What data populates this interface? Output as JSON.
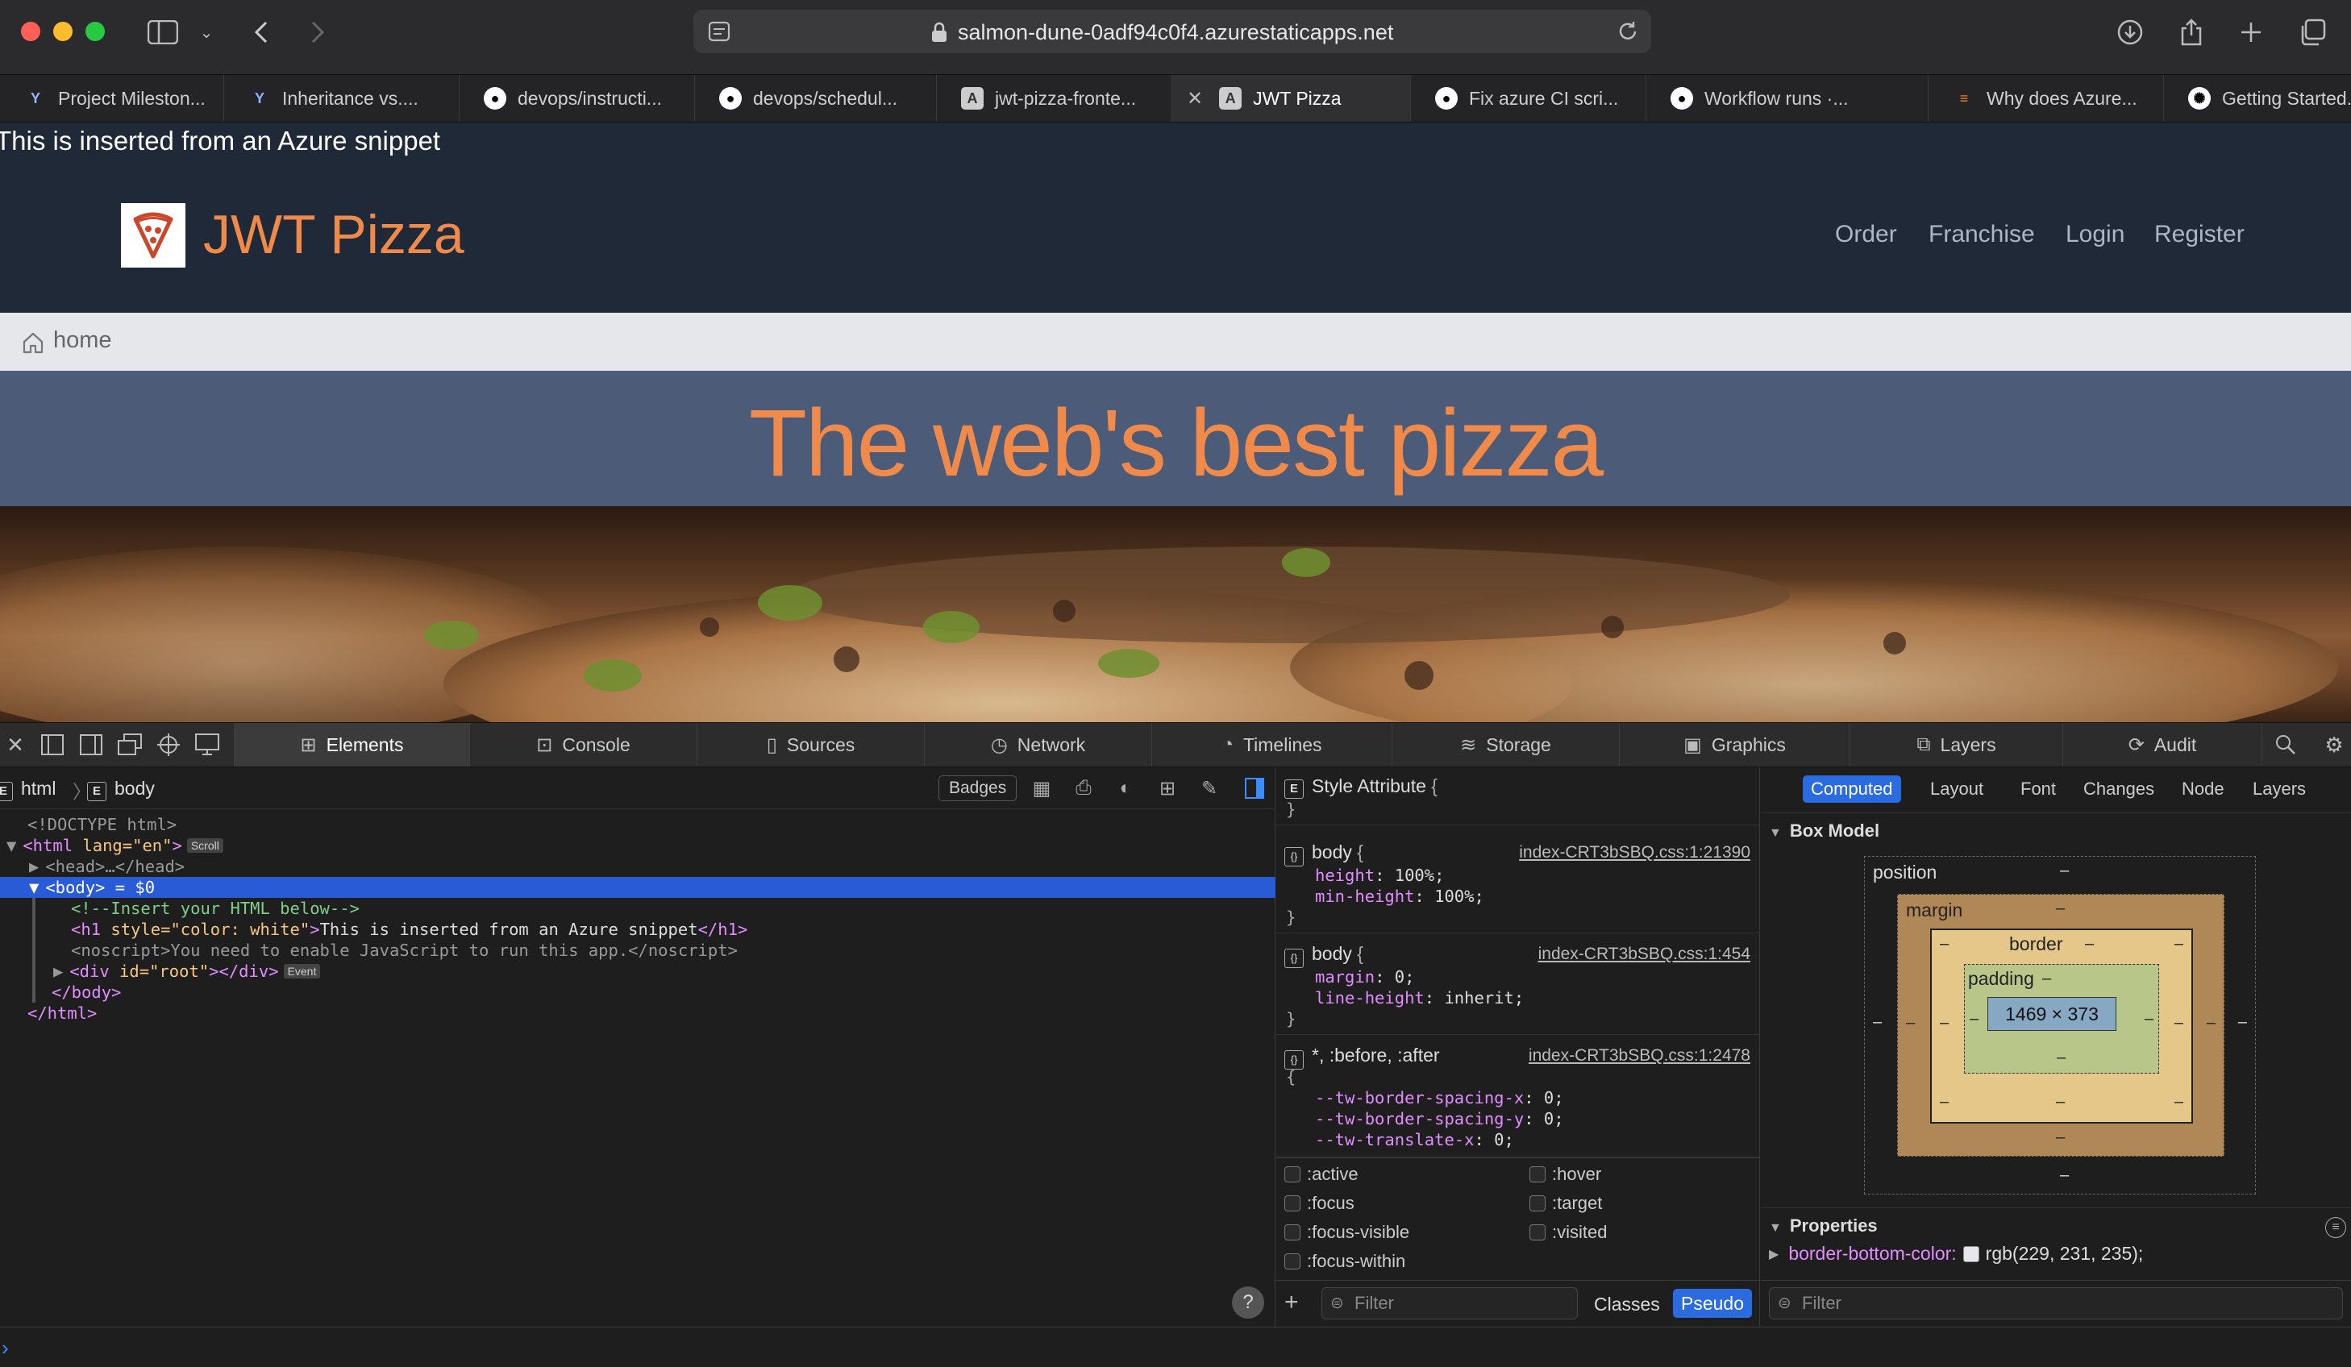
{
  "browser": {
    "url": "salmon-dune-0adf94c0f4.azurestaticapps.net",
    "tabs": [
      {
        "label": "Project Mileston...",
        "icon": "azure-devops-icon"
      },
      {
        "label": "Inheritance vs....",
        "icon": "azure-devops-icon"
      },
      {
        "label": "devops/instructi...",
        "icon": "github-icon"
      },
      {
        "label": "devops/schedul...",
        "icon": "github-icon"
      },
      {
        "label": "jwt-pizza-fronte...",
        "icon": "a-icon"
      },
      {
        "label": "JWT Pizza",
        "icon": "a-icon"
      },
      {
        "label": "Fix azure CI scri...",
        "icon": "github-icon"
      },
      {
        "label": "Workflow runs ·...",
        "icon": "github-icon"
      },
      {
        "label": "Why does Azure...",
        "icon": "stackoverflow-icon"
      },
      {
        "label": "Getting Started...",
        "icon": "openai-icon"
      }
    ]
  },
  "page": {
    "snippet_text": "This is inserted from an Azure snippet",
    "brand": "JWT Pizza",
    "nav": [
      "Order",
      "Franchise",
      "Login",
      "Register"
    ],
    "breadcrumb": "home",
    "headline": "The web's best pizza",
    "colors": {
      "brand": "#f08a4b",
      "header_bg": "#1f2937",
      "hero_bg": "#4c5b78"
    }
  },
  "devtools": {
    "tabs": [
      "Elements",
      "Console",
      "Sources",
      "Network",
      "Timelines",
      "Storage",
      "Graphics",
      "Layers",
      "Audit"
    ],
    "active_tab": "Elements",
    "crumbs": {
      "html": "html",
      "body": "body",
      "badge_letter": "E"
    },
    "badges_label": "Badges",
    "dom": {
      "doctype": "<!DOCTYPE html>",
      "html_open": "<html",
      "lang_attr": " lang=",
      "lang_val": "\"en\"",
      "html_close_bracket": ">",
      "scroll_badge": "Scroll",
      "head_line": "<head>…</head>",
      "body_open": "<body>",
      "body_ref": " = $0",
      "comment": "<!--Insert your HTML below-->",
      "h1_open": "<h1",
      "style_attr": " style=",
      "style_val": "\"color: white\"",
      "h1_gt": ">",
      "h1_text": "This is inserted from an Azure snippet",
      "h1_close": "</h1>",
      "noscript_open": "<noscript>",
      "noscript_text": "You need to enable JavaScript to run this app.",
      "noscript_close": "</noscript>",
      "div_open": "<div",
      "id_attr": " id=",
      "id_val": "\"root\"",
      "div_close": "></div>",
      "event_badge": "Event",
      "body_close": "</body>",
      "html_close": "</html>"
    },
    "help": "?",
    "styles": {
      "style_attribute": "Style Attribute",
      "rules": [
        {
          "selector": "body",
          "source": "index-CRT3bSBQ.css:1:21390",
          "decls": [
            [
              "height",
              "100%"
            ],
            [
              "min-height",
              "100%"
            ]
          ]
        },
        {
          "selector": "body",
          "source": "index-CRT3bSBQ.css:1:454",
          "decls": [
            [
              "margin",
              "0"
            ],
            [
              "line-height",
              "inherit"
            ]
          ]
        },
        {
          "selector": "*, :before, :after",
          "source": "index-CRT3bSBQ.css:1:2478",
          "decls": [
            [
              "--tw-border-spacing-x",
              "0"
            ],
            [
              "--tw-border-spacing-y",
              "0"
            ],
            [
              "--tw-translate-x",
              "0"
            ]
          ]
        }
      ],
      "pseudo_left": [
        ":active",
        ":focus",
        ":focus-visible",
        ":focus-within"
      ],
      "pseudo_right": [
        ":hover",
        ":target",
        ":visited"
      ],
      "filter_placeholder": "Filter",
      "classes_label": "Classes",
      "pseudo_label": "Pseudo"
    },
    "computed": {
      "tabs": [
        "Computed",
        "Layout",
        "Font",
        "Changes",
        "Node",
        "Layers"
      ],
      "active": "Computed",
      "box_model_title": "Box Model",
      "position_label": "position",
      "margin_label": "margin",
      "border_label": "border",
      "padding_label": "padding",
      "content_size": "1469 × 373",
      "dash": "–",
      "properties_title": "Properties",
      "property_name": "border-bottom-color:",
      "property_value": "rgb(229, 231, 235)",
      "property_swatch": "#e5e7eb",
      "filter_placeholder": "Filter"
    }
  }
}
